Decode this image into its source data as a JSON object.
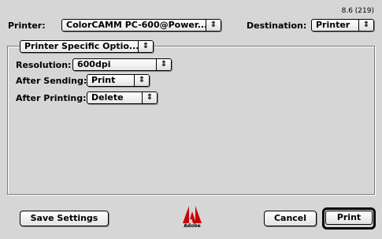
{
  "version": "8.6 (219)",
  "printer": {
    "label": "Printer:",
    "value": "ColorCAMM PC-600@Power..."
  },
  "destination": {
    "label": "Destination:",
    "value": "Printer"
  },
  "panel_selector": {
    "value": "Printer Specific Optio..."
  },
  "options": {
    "resolution": {
      "label": "Resolution:",
      "value": "600dpi"
    },
    "after_sending": {
      "label": "After Sending:",
      "value": "Print"
    },
    "after_printing": {
      "label": "After Printing:",
      "value": "Delete"
    }
  },
  "buttons": {
    "save_settings": "Save Settings",
    "cancel": "Cancel",
    "print": "Print"
  },
  "logo": {
    "name": "adobe-logo-icon",
    "text": "Adobe",
    "color": "#cc0000"
  },
  "icons": {
    "popup_arrow": "⇕"
  }
}
